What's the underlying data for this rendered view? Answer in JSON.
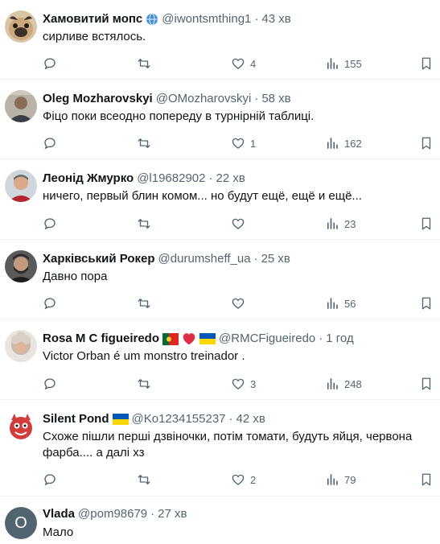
{
  "posts": [
    {
      "name": "Хамовитий мопс",
      "handle": "@iwontsmthing1",
      "time": "43 хв",
      "text": "сирливе встялось.",
      "likes": "4",
      "views": "155",
      "avatar": "pug-avatar",
      "badges": [
        "globe-icon"
      ]
    },
    {
      "name": "Oleg Mozharovskyi",
      "handle": "@OMozharovskyi",
      "time": "58 хв",
      "text": "Фіцо поки всеодно попереду в турнірній таблиці.",
      "likes": "1",
      "views": "162",
      "avatar": "photo-avatar",
      "badges": []
    },
    {
      "name": "Леонід Жмурко",
      "handle": "@l19682902",
      "time": "22 хв",
      "text": "ничего, первый блин комом... но будут ещё, ещё и ещё...",
      "likes": "",
      "views": "23",
      "avatar": "photo-avatar",
      "badges": []
    },
    {
      "name": "Харківський Рокер",
      "handle": "@durumsheff_ua",
      "time": "25 хв",
      "text": "Давно пора",
      "likes": "",
      "views": "56",
      "avatar": "photo-avatar",
      "badges": []
    },
    {
      "name": "Rosa M C figueiredo",
      "handle": "@RMCFigueiredo",
      "time": "1 год",
      "text": "Victor Orban é um monstro treinador  .",
      "likes": "3",
      "views": "248",
      "avatar": "photo-avatar",
      "badges": [
        "portugal-flag-icon",
        "heart-emoji-icon",
        "ukraine-flag-icon"
      ]
    },
    {
      "name": "Silent Pond",
      "handle": "@Ko1234155237",
      "time": "42 хв",
      "text": "Схоже пішли перші дзвіночки, потім томати, будуть яйця, червона фарба.... а далі хз",
      "likes": "2",
      "views": "79",
      "avatar": "monster-avatar",
      "badges": [
        "ukraine-flag-icon"
      ]
    },
    {
      "name": "Vlada",
      "handle": "@pom98679",
      "time": "27 хв",
      "text": "Мало",
      "likes": "",
      "views": "",
      "avatar": "letter-avatar",
      "avatar_letter": "O",
      "badges": []
    }
  ],
  "colors": {
    "text": "#0f1419",
    "secondary": "#536471",
    "divider": "#eff3f4",
    "letter_avatar_bg": "#536471"
  }
}
